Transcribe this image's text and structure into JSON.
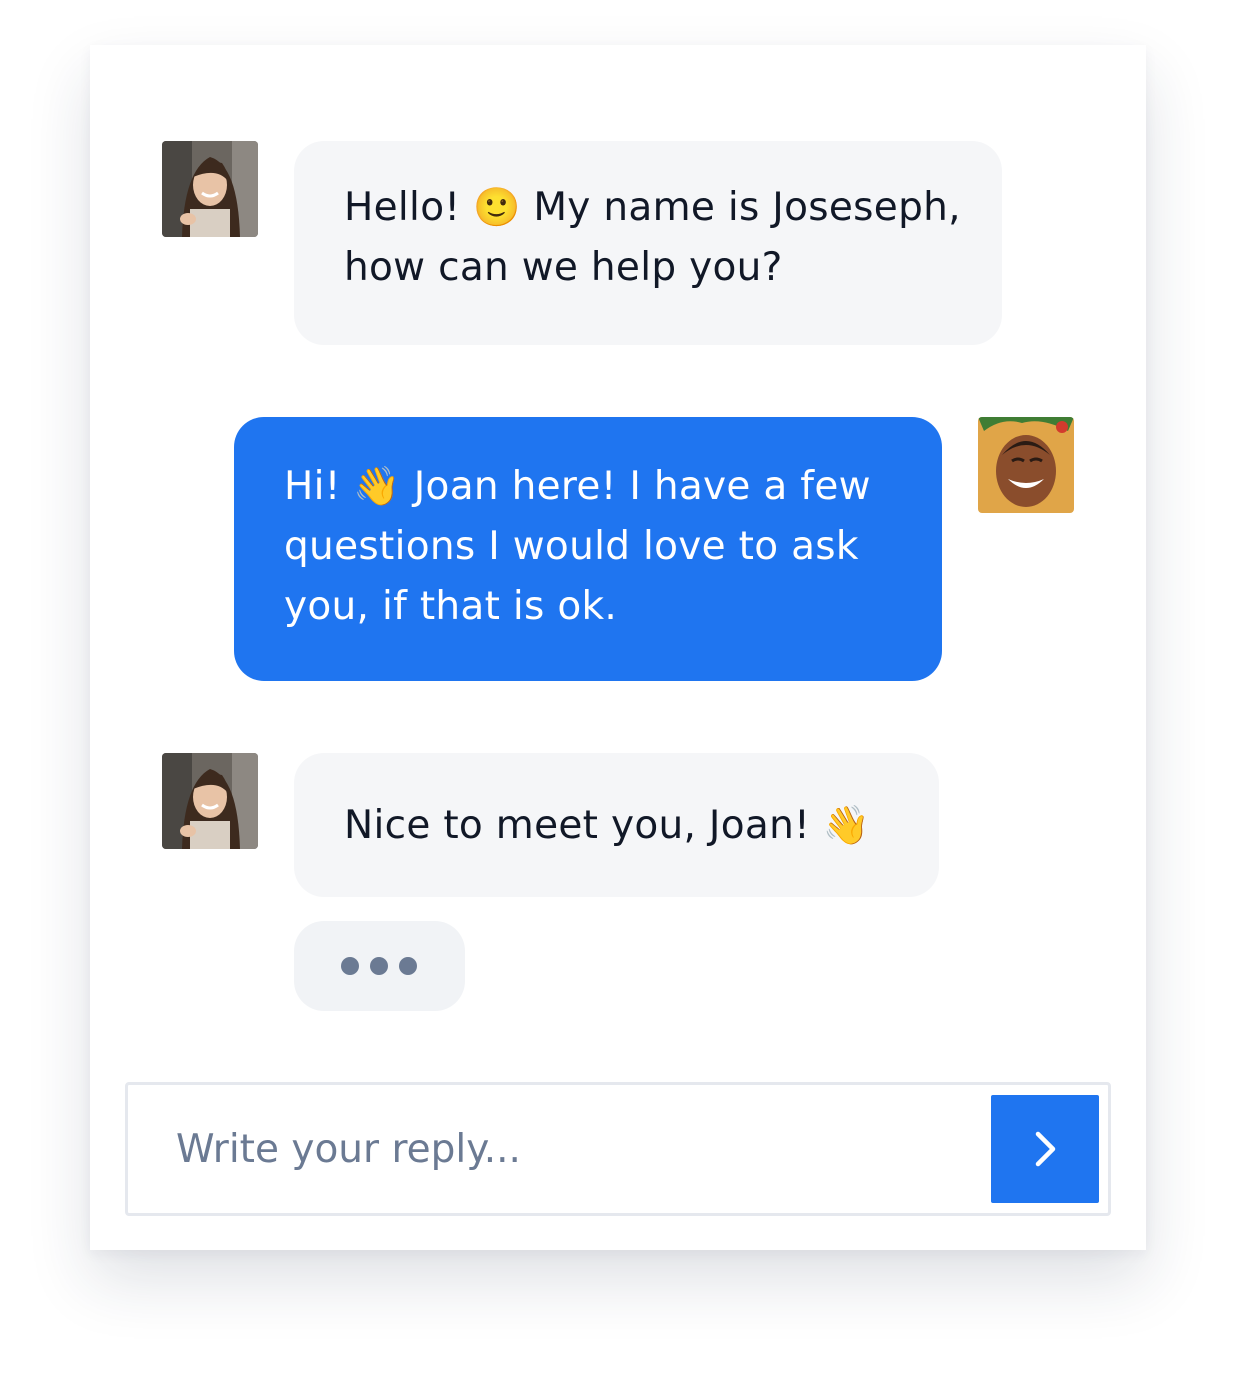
{
  "conversation": {
    "messages": [
      {
        "sender": "agent",
        "avatar_icon": "agent-avatar",
        "text_before": "Hello!",
        "emoji": "🙂",
        "text_after": "My name is Joseseph, how can we help you?"
      },
      {
        "sender": "customer",
        "avatar_icon": "customer-avatar",
        "text_before": "Hi!",
        "emoji": "👋",
        "text_after": "Joan here! I have a few questions I would love to ask you, if that is ok."
      },
      {
        "sender": "agent",
        "avatar_icon": "agent-avatar",
        "text_before": "Nice to meet you, Joan!",
        "emoji": "👋",
        "text_after": ""
      }
    ],
    "typing_indicator": {
      "visible": true,
      "icon": "typing-dots-icon"
    }
  },
  "composer": {
    "value": "",
    "placeholder": "Write your reply...",
    "send_icon": "chevron-right-icon"
  },
  "colors": {
    "accent": "#1f75f0",
    "incoming_bubble": "#f5f6f8",
    "typing_dots": "#6b7a93"
  }
}
